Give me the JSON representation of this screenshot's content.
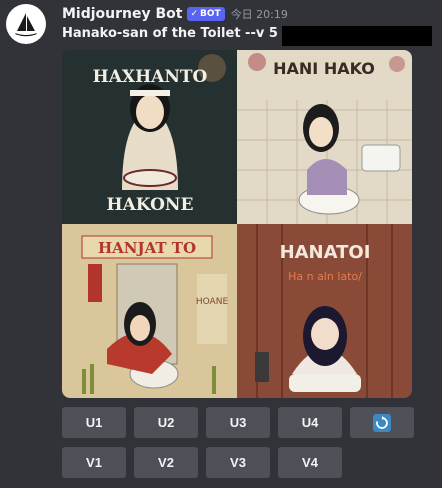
{
  "message": {
    "author": "Midjourney Bot",
    "bot_badge": "BOT",
    "bot_badge_check": "✓",
    "timestamp": "今日 20:19",
    "prompt": "Hanako-san of the Toilet --v 5 -"
  },
  "images": [
    {
      "caption": "HAXHANTO",
      "subcaption": "HAKONE"
    },
    {
      "caption": "HANI HAKO"
    },
    {
      "caption": "HANJAT TO",
      "side_text": "HOANE"
    },
    {
      "caption": "HANATOI",
      "subcaption": "Ha n aln lato/"
    }
  ],
  "buttons": {
    "upscale": [
      "U1",
      "U2",
      "U3",
      "U4"
    ],
    "variation": [
      "V1",
      "V2",
      "V3",
      "V4"
    ],
    "reroll_icon": "🔄"
  },
  "colors": {
    "background": "#313338",
    "button": "#4e5058",
    "badge": "#5865f2",
    "reroll": "#3b88c3"
  }
}
